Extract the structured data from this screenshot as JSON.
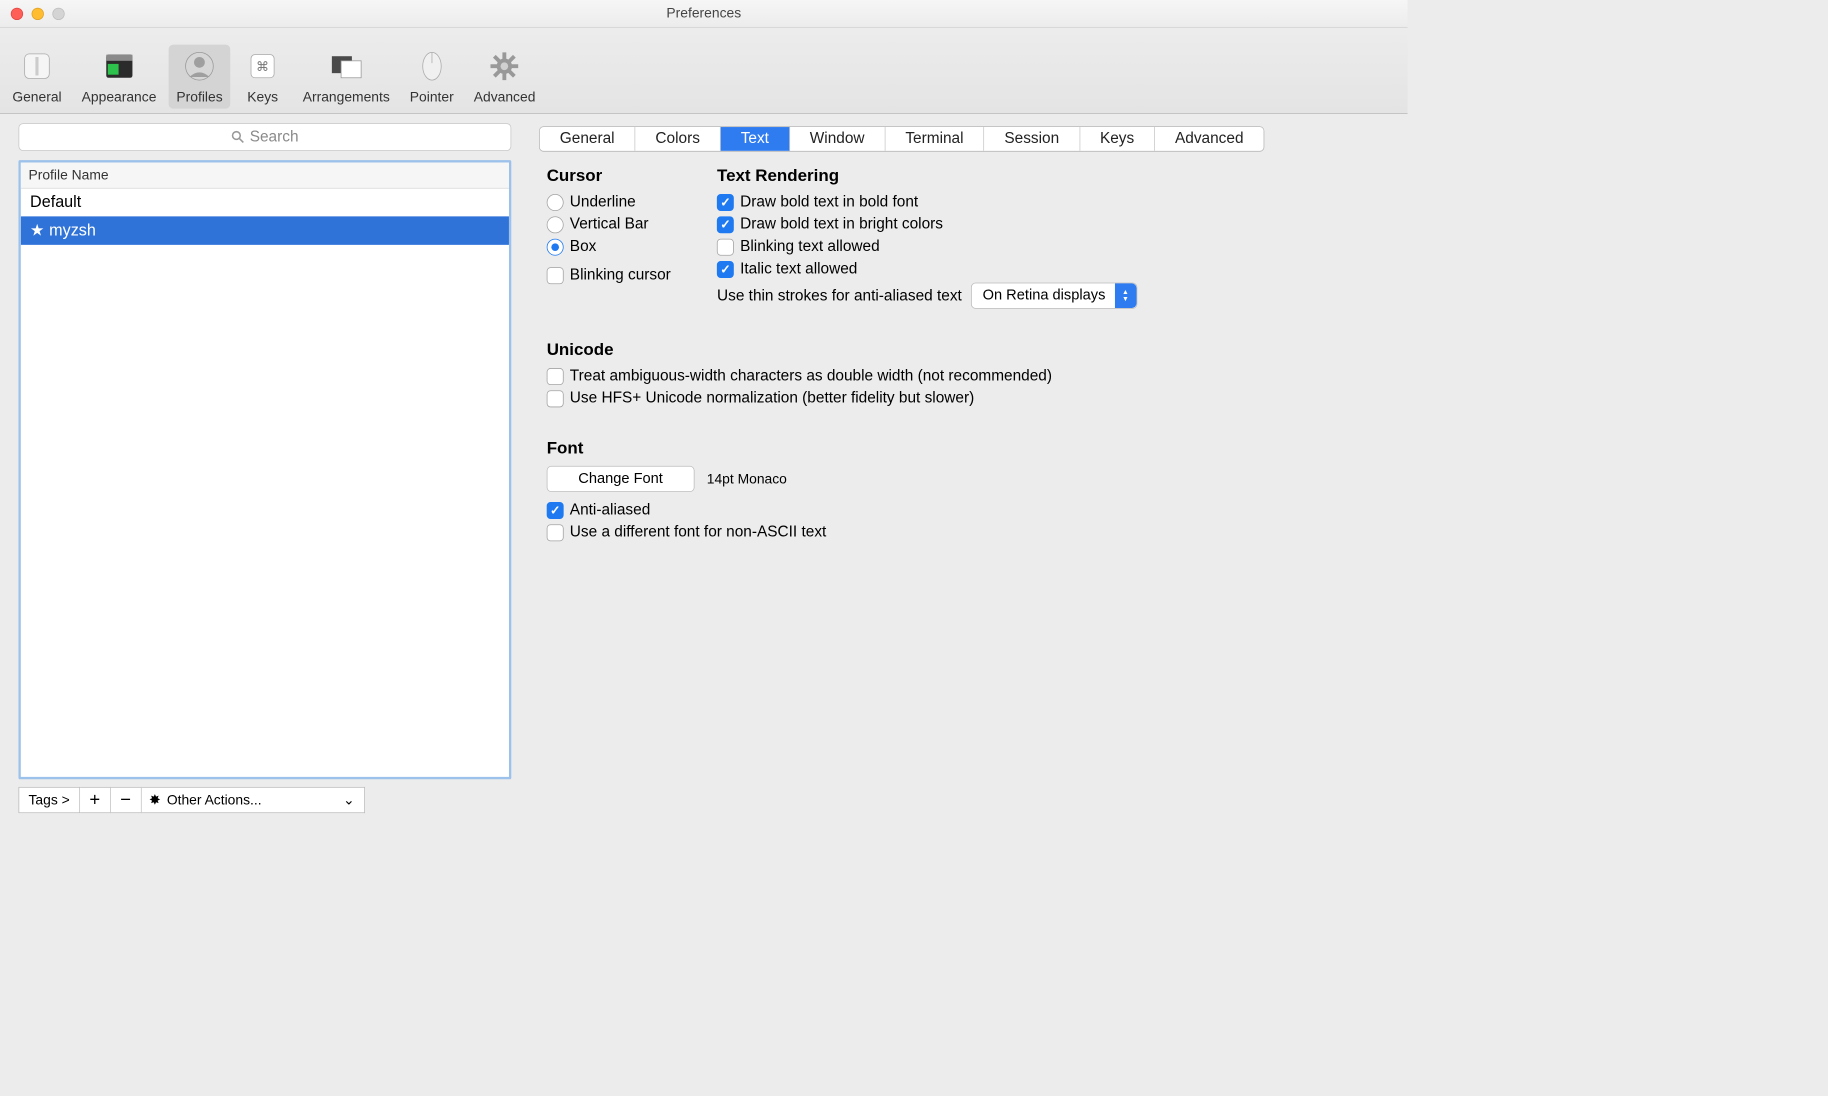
{
  "window": {
    "title": "Preferences"
  },
  "toolbar": {
    "items": [
      {
        "name": "general",
        "label": "General"
      },
      {
        "name": "appearance",
        "label": "Appearance"
      },
      {
        "name": "profiles",
        "label": "Profiles",
        "active": true
      },
      {
        "name": "keys",
        "label": "Keys"
      },
      {
        "name": "arrangements",
        "label": "Arrangements"
      },
      {
        "name": "pointer",
        "label": "Pointer"
      },
      {
        "name": "advanced",
        "label": "Advanced"
      }
    ]
  },
  "sidebar": {
    "search_placeholder": "Search",
    "list_header": "Profile Name",
    "profiles": [
      {
        "name": "Default",
        "starred": false,
        "selected": false
      },
      {
        "name": "myzsh",
        "starred": true,
        "selected": true
      }
    ],
    "tags_label": "Tags >",
    "actions_label": "Other Actions..."
  },
  "tabs": [
    {
      "label": "General"
    },
    {
      "label": "Colors"
    },
    {
      "label": "Text",
      "active": true
    },
    {
      "label": "Window"
    },
    {
      "label": "Terminal"
    },
    {
      "label": "Session"
    },
    {
      "label": "Keys"
    },
    {
      "label": "Advanced"
    }
  ],
  "cursor": {
    "heading": "Cursor",
    "options": [
      {
        "label": "Underline",
        "checked": false
      },
      {
        "label": "Vertical Bar",
        "checked": false
      },
      {
        "label": "Box",
        "checked": true
      }
    ],
    "blinking": {
      "label": "Blinking cursor",
      "checked": false
    }
  },
  "text_rendering": {
    "heading": "Text Rendering",
    "options": [
      {
        "label": "Draw bold text in bold font",
        "checked": true
      },
      {
        "label": "Draw bold text in bright colors",
        "checked": true
      },
      {
        "label": "Blinking text allowed",
        "checked": false
      },
      {
        "label": "Italic text allowed",
        "checked": true
      }
    ],
    "thin_strokes_label": "Use thin strokes for anti-aliased text",
    "thin_strokes_value": "On Retina displays"
  },
  "unicode": {
    "heading": "Unicode",
    "options": [
      {
        "label": "Treat ambiguous-width characters as double width (not recommended)",
        "checked": false
      },
      {
        "label": "Use HFS+ Unicode normalization (better fidelity but slower)",
        "checked": false
      }
    ]
  },
  "font": {
    "heading": "Font",
    "change_label": "Change Font",
    "current": "14pt Monaco",
    "anti_aliased": {
      "label": "Anti-aliased",
      "checked": true
    },
    "non_ascii": {
      "label": "Use a different font for non-ASCII text",
      "checked": false
    }
  }
}
